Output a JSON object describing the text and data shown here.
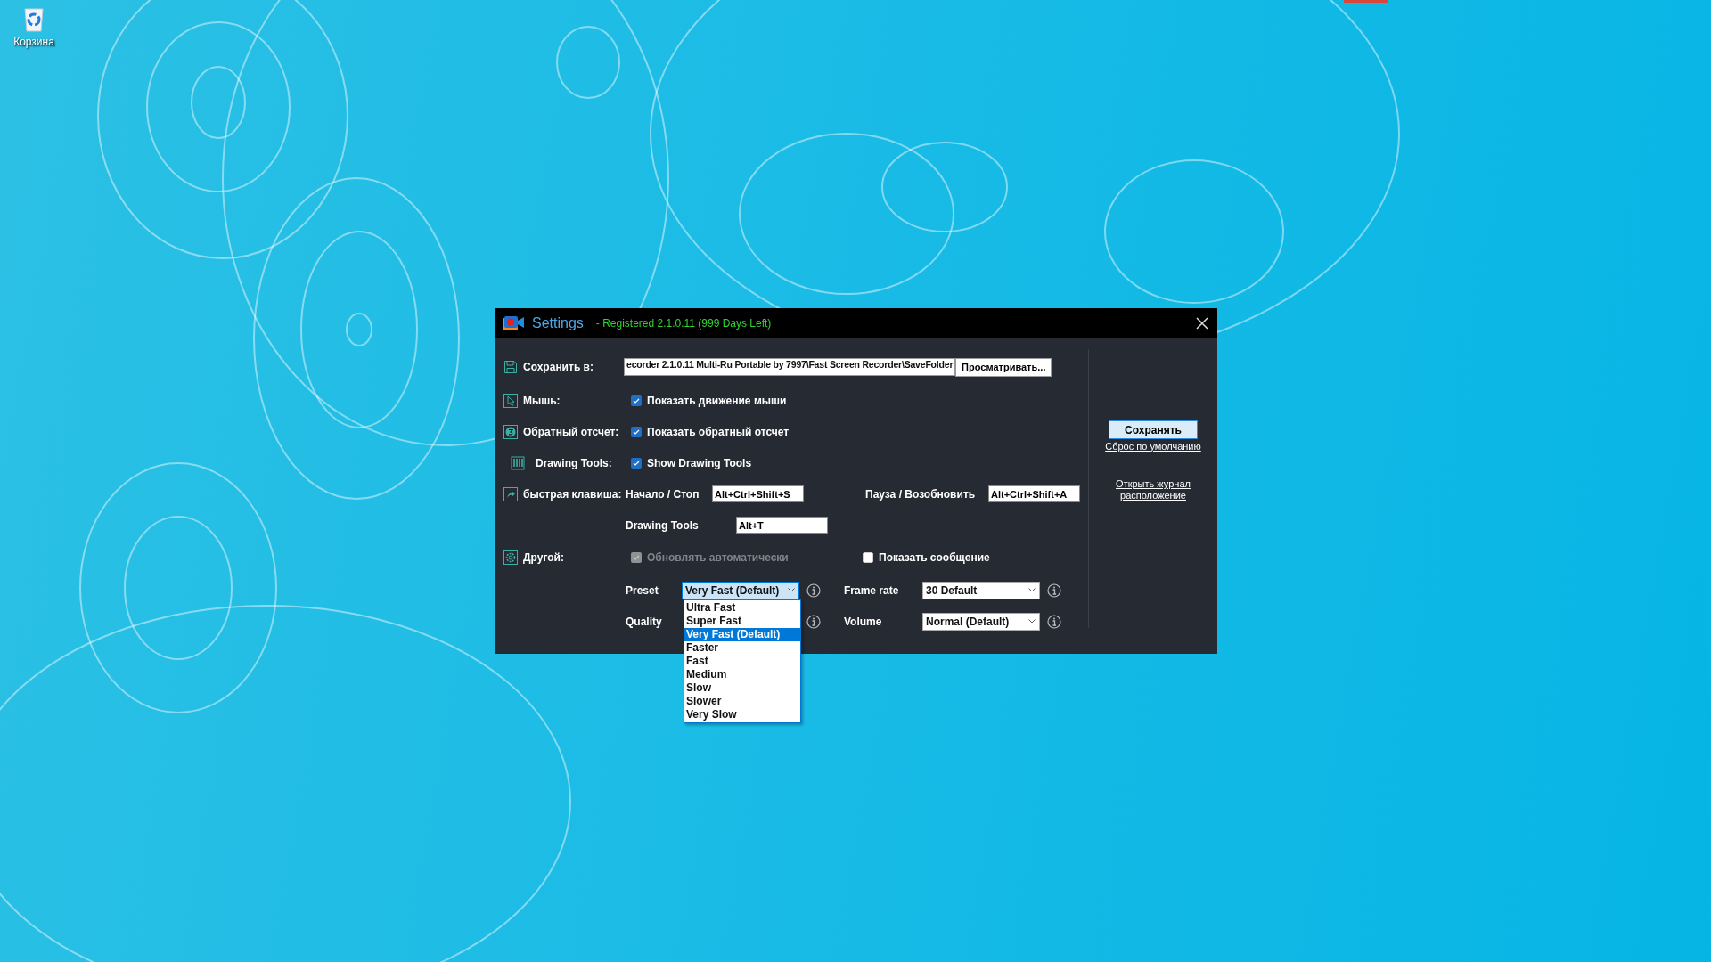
{
  "desktop": {
    "icons": [
      {
        "label": "Корзина"
      }
    ]
  },
  "window": {
    "title": "Settings",
    "registration": "- Registered 2.1.0.11 (999 Days Left)"
  },
  "save_to": {
    "label": "Сохранить в:",
    "path": "ecorder 2.1.0.11 Multi-Ru Portable by 7997\\Fast Screen Recorder\\SaveFolder",
    "browse": "Просматривать..."
  },
  "toggles": [
    {
      "kind": "mouse",
      "label": "Мышь:",
      "option": "Показать движение мыши",
      "checked": true
    },
    {
      "kind": "countdown",
      "label": "Обратный отсчет:",
      "option": "Показать обратный отсчет",
      "checked": true
    },
    {
      "kind": "drawing",
      "label": "Drawing Tools:",
      "option": "Show Drawing Tools",
      "checked": true
    }
  ],
  "hotkeys": {
    "label": "быстрая клавиша:",
    "items": [
      {
        "label": "Начало / Стоп",
        "value": "Alt+Ctrl+Shift+S"
      },
      {
        "label": "Пауза / Возобновить",
        "value": "Alt+Ctrl+Shift+A"
      },
      {
        "label": "Drawing Tools",
        "value": "Alt+T"
      }
    ]
  },
  "other": {
    "label": "Другой:",
    "options": [
      {
        "label": "Обновлять автоматически",
        "checked": true,
        "disabled": true
      },
      {
        "label": "Показать сообщение",
        "checked": false,
        "disabled": false
      }
    ]
  },
  "encoding": {
    "preset": {
      "label": "Preset",
      "value": "Very Fast (Default)",
      "expanded": true,
      "options": [
        {
          "label": "Ultra Fast",
          "selected": false
        },
        {
          "label": "Super Fast",
          "selected": false
        },
        {
          "label": "Very Fast (Default)",
          "selected": true
        },
        {
          "label": "Faster",
          "selected": false
        },
        {
          "label": "Fast",
          "selected": false
        },
        {
          "label": "Medium",
          "selected": false
        },
        {
          "label": "Slow",
          "selected": false
        },
        {
          "label": "Slower",
          "selected": false
        },
        {
          "label": "Very Slow",
          "selected": false
        }
      ]
    },
    "frame_rate": {
      "label": "Frame rate",
      "value": "30 Default"
    },
    "quality": {
      "label": "Quality"
    },
    "volume": {
      "label": "Volume",
      "value": "Normal (Default)"
    }
  },
  "actions": {
    "save": "Сохранять",
    "reset": "Сброс по умолчанию",
    "open_log": "Открыть журнал расположение"
  }
}
